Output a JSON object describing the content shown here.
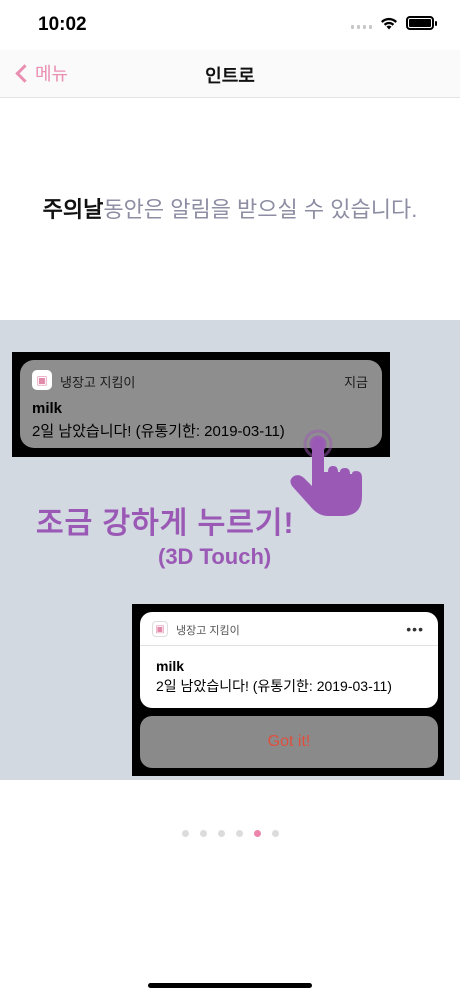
{
  "status_bar": {
    "time": "10:02"
  },
  "nav": {
    "back_label": "메뉴",
    "title": "인트로"
  },
  "headline": {
    "emphasis": "주의날",
    "rest": "동안은 알림을 받으실 수 있습니다."
  },
  "illustration": {
    "notification": {
      "app_name": "냉장고 지킴이",
      "time": "지금",
      "title": "milk",
      "body": "2일 남았습니다! (유통기한: 2019-03-11)"
    },
    "touch_text": "조금 강하게 누르기!",
    "touch_sub": "(3D Touch)",
    "detail": {
      "app_name": "냉장고 지킴이",
      "title": "milk",
      "body": "2일 남았습니다! (유통기한: 2019-03-11)",
      "action_label": "Got it!"
    }
  },
  "page_indicator": {
    "total": 6,
    "active_index": 4
  },
  "colors": {
    "accent_pink": "#ec86ad",
    "touch_purple": "#9b59b6",
    "action_red": "#e04f3e"
  }
}
